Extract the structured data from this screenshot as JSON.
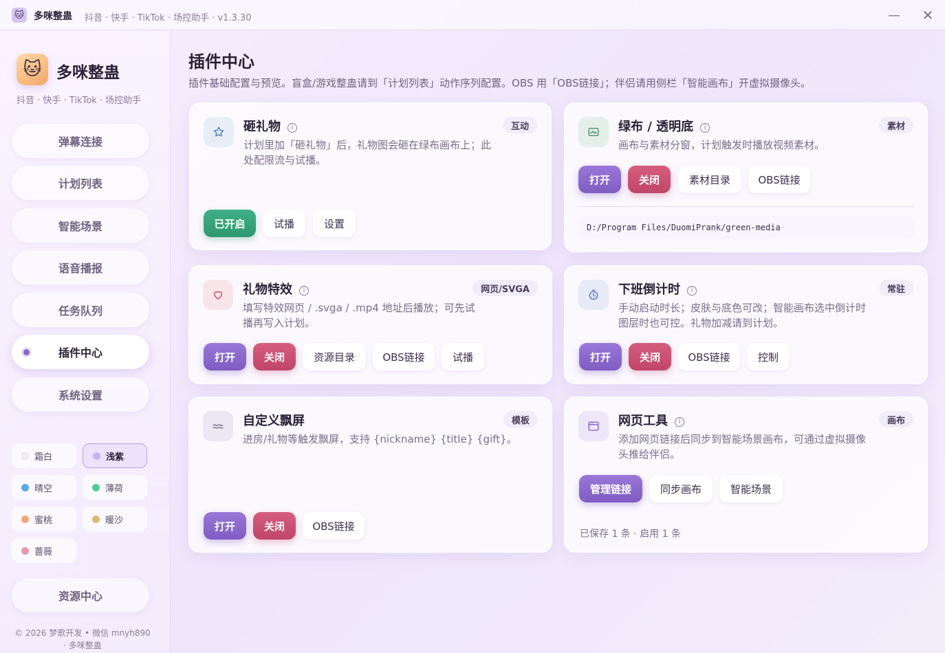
{
  "titlebar": {
    "app_name": "多咪整蛊",
    "subtitle": "抖音 · 快手 · TikTok · 场控助手 · v1.3.30",
    "minimize_glyph": "—",
    "close_glyph": "✕"
  },
  "sidebar": {
    "title": "多咪整蛊",
    "subtitle": "抖音 · 快手 · TikTok · 场控助手",
    "nav": [
      {
        "label": "弹幕连接"
      },
      {
        "label": "计划列表"
      },
      {
        "label": "智能场景"
      },
      {
        "label": "语音播报"
      },
      {
        "label": "任务队列"
      },
      {
        "label": "插件中心"
      },
      {
        "label": "系统设置"
      }
    ],
    "active_nav": "插件中心",
    "themes": [
      {
        "label": "霜白",
        "color": "#f2eef8"
      },
      {
        "label": "浅紫",
        "color": "#c7b4ee"
      },
      {
        "label": "晴空",
        "color": "#5aa9e6"
      },
      {
        "label": "薄荷",
        "color": "#55c99a"
      },
      {
        "label": "蜜桃",
        "color": "#f2a77b"
      },
      {
        "label": "暖沙",
        "color": "#d9b977"
      },
      {
        "label": "蔷薇",
        "color": "#e79aaa"
      }
    ],
    "active_theme": "浅紫",
    "resource_center": "资源中心",
    "footer_line1": "© 2026 梦歌开发 • 微信 mnyh890",
    "footer_line2": "· 多咪整蛊"
  },
  "main": {
    "title": "插件中心",
    "description": "插件基础配置与预览。盲盒/游戏整蛊请到「计划列表」动作序列配置。OBS 用「OBS链接」；伴侣请用侧栏「智能画布」开虚拟摄像头。",
    "cards": {
      "smash": {
        "title": "砸礼物",
        "badge": "互动",
        "desc": "计划里加「砸礼物」后，礼物图会砸在绿布画布上；此处配限流与试播。",
        "buttons": [
          "已开启",
          "试播",
          "设置"
        ]
      },
      "green": {
        "title": "绿布 / 透明底",
        "badge": "素材",
        "desc": "画布与素材分窗，计划触发时播放视频素材。",
        "buttons": [
          "打开",
          "关闭",
          "素材目录",
          "OBS链接"
        ],
        "path": "D:/Program Files/DuomiPrank/green-media"
      },
      "effects": {
        "title": "礼物特效",
        "badge": "网页/SVGA",
        "desc": "填写特效网页 / .svga / .mp4 地址后播放；可先试播再写入计划。",
        "buttons": [
          "打开",
          "关闭",
          "资源目录",
          "OBS链接",
          "试播"
        ]
      },
      "timer": {
        "title": "下班倒计时",
        "badge": "常驻",
        "desc": "手动启动时长；皮肤与底色可改；智能画布选中倒计时图层时也可控。礼物加减请到计划。",
        "buttons": [
          "打开",
          "关闭",
          "OBS链接",
          "控制"
        ]
      },
      "danmu": {
        "title": "自定义飘屏",
        "badge": "模板",
        "desc": "进房/礼物等触发飘屏，支持 {nickname} {title} {gift}。",
        "buttons": [
          "打开",
          "关闭",
          "OBS链接"
        ]
      },
      "web": {
        "title": "网页工具",
        "badge": "画布",
        "desc": "添加网页链接后同步到智能场景画布，可通过虚拟摄像头推给伴侣。",
        "buttons": [
          "管理链接",
          "同步画布",
          "智能场景"
        ],
        "status": "已保存 1 条 · 启用 1 条"
      }
    }
  },
  "colors": {
    "accent_purple": "#8b67c9",
    "danger_red": "#c0466a",
    "success_green": "#2f9870"
  },
  "icons": {
    "smash": "star-icon",
    "green": "image-icon",
    "effects": "heart-icon",
    "timer": "clock-icon",
    "danmu": "wave-icon",
    "web": "browser-icon"
  }
}
